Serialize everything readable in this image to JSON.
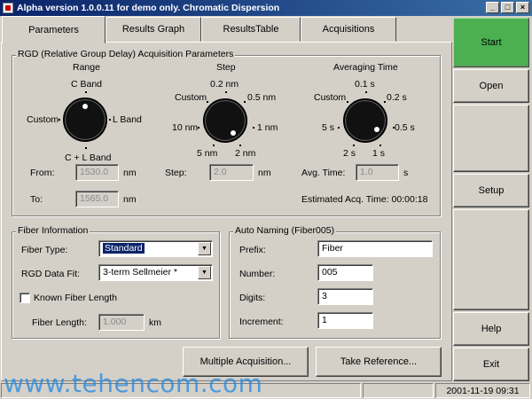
{
  "window": {
    "title": "Alpha version 1.0.0.11 for demo only.  Chromatic Dispersion",
    "min_glyph": "_",
    "max_glyph": "□",
    "close_glyph": "×"
  },
  "tabs": [
    {
      "label": "Parameters",
      "active": true
    },
    {
      "label": "Results Graph",
      "active": false
    },
    {
      "label": "ResultsTable",
      "active": false
    },
    {
      "label": "Acquisitions",
      "active": false
    }
  ],
  "rgd": {
    "title": "RGD (Relative Group Delay) Acquisition Parameters",
    "range": {
      "heading": "Range",
      "top": "C Band",
      "left": "Custom",
      "right": "L Band",
      "bottom": "C + L Band",
      "from_label": "From:",
      "from_value": "1530.0",
      "from_unit": "nm",
      "to_label": "To:",
      "to_value": "1565.0",
      "to_unit": "nm"
    },
    "step": {
      "heading": "Step",
      "top": "0.2 nm",
      "top_left": "Custom",
      "top_right": "0.5 nm",
      "left": "10 nm",
      "right": "1 nm",
      "bottom_left": "5 nm",
      "bottom_right": "2 nm",
      "step_label": "Step:",
      "step_value": "2.0",
      "step_unit": "nm"
    },
    "averaging": {
      "heading": "Averaging Time",
      "top": "0.1 s",
      "top_left": "Custom",
      "top_right": "0.2 s",
      "left": "5 s",
      "right": "0.5 s",
      "bottom_left": "2 s",
      "bottom_right": "1 s",
      "avg_label": "Avg. Time:",
      "avg_value": "1.0",
      "avg_unit": "s",
      "estimated": "Estimated Acq. Time:  00:00:18"
    }
  },
  "fiber": {
    "title": "Fiber Information",
    "type_label": "Fiber Type:",
    "type_value": "Standard",
    "fit_label": "RGD Data Fit:",
    "fit_value": "3-term Sellmeier *",
    "known_length_label": "Known Fiber Length",
    "length_label": "Fiber Length:",
    "length_value": "1.000",
    "length_unit": "km"
  },
  "naming": {
    "title": "Auto Naming (Fiber005)",
    "prefix_label": "Prefix:",
    "prefix_value": "Fiber",
    "number_label": "Number:",
    "number_value": "005",
    "digits_label": "Digits:",
    "digits_value": "3",
    "increment_label": "Increment:",
    "increment_value": "1"
  },
  "buttons": {
    "multiple": "Multiple Acquisition...",
    "reference": "Take Reference..."
  },
  "side": {
    "start": "Start",
    "open": "Open",
    "setup": "Setup",
    "help": "Help",
    "exit": "Exit"
  },
  "status": {
    "datetime": "2001-11-19 09:31"
  },
  "watermark": "www.tehencom.com",
  "colors": {
    "start_green": "#4caf50",
    "titlebar": "#0a246a",
    "selection": "#0a246a",
    "watermark": "#1e88e5"
  }
}
